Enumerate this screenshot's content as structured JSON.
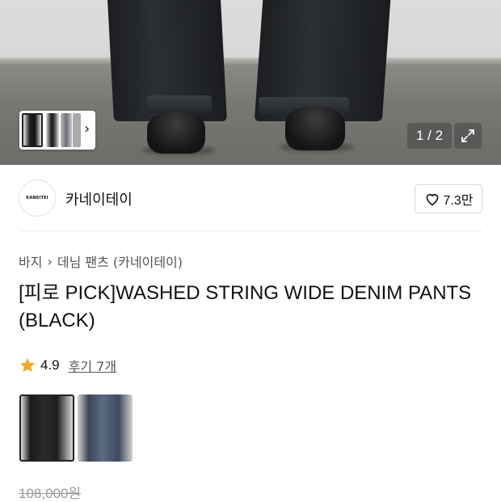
{
  "gallery": {
    "counter": "1 / 2",
    "thumb_next_icon": "chevron-right-icon",
    "expand_icon": "expand-icon"
  },
  "brand": {
    "logo_text": "KANEITEI",
    "name": "카네이테이",
    "like_icon": "heart-outline-icon",
    "like_count": "7.3만"
  },
  "breadcrumb": {
    "category": "바지",
    "subcategory": "데님 팬츠 (카네이테이)"
  },
  "product": {
    "title": "[피로 PICK]WASHED STRING WIDE DENIM PANTS (BLACK)",
    "rating": "4.9",
    "reviews": "후기 7개",
    "original_price": "108,000원"
  },
  "options": [
    {
      "name": "BLACK",
      "selected": true
    },
    {
      "name": "BLUE",
      "selected": false
    }
  ],
  "colors": {
    "star": "#F5A623",
    "text": "#111111",
    "muted": "#999999"
  }
}
